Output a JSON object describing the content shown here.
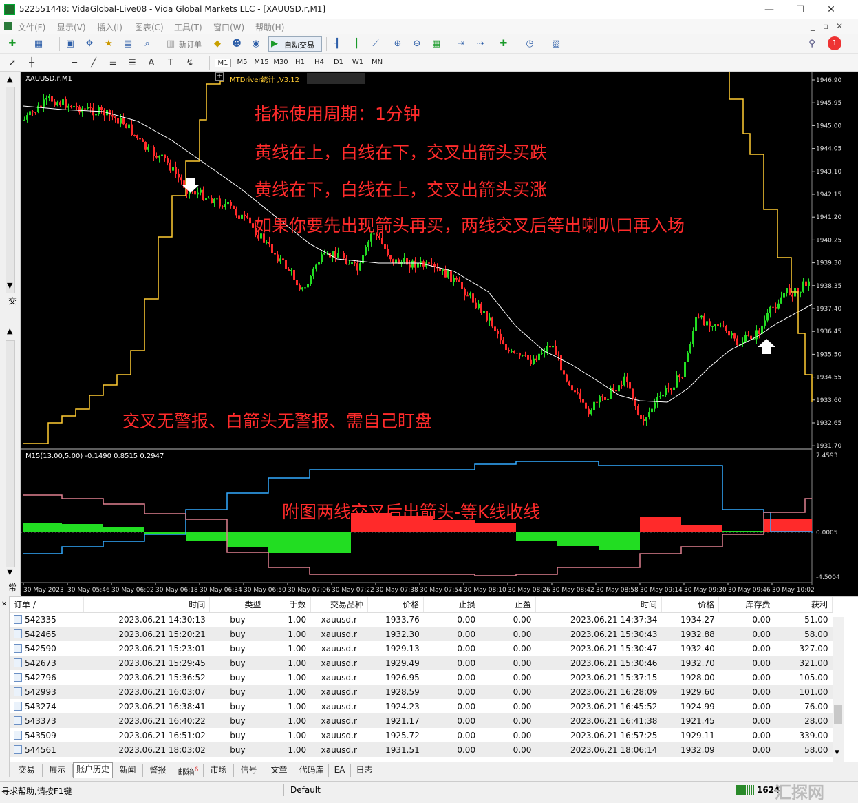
{
  "window": {
    "title": "522551448: VidaGlobal-Live08 - Vida Global Markets LLC - [XAUUSD.r,M1]"
  },
  "menu": [
    "文件(F)",
    "显示(V)",
    "插入(I)",
    "图表(C)",
    "工具(T)",
    "窗口(W)",
    "帮助(H)"
  ],
  "toolbar": {
    "new_order": "新订单",
    "auto_trade": "自动交易"
  },
  "timeframes": [
    "M1",
    "M5",
    "M15",
    "M30",
    "H1",
    "H4",
    "D1",
    "W1",
    "MN"
  ],
  "left_panel": {
    "tab1": "交",
    "tab2": "常"
  },
  "chart": {
    "symbol_label": "XAUUSD.r,M1",
    "indicator_label": "MTDriver统计 ,V3.12",
    "sub_label": "M15(13.00,5.00) -0.1490 0.8515 0.2947",
    "price_ticks": [
      "1946.90",
      "1945.95",
      "1945.00",
      "1944.05",
      "1943.10",
      "1942.15",
      "1941.20",
      "1940.25",
      "1939.30",
      "1938.35",
      "1937.40",
      "1936.45",
      "1935.50",
      "1934.55",
      "1933.60",
      "1932.65",
      "1931.70"
    ],
    "sub_ticks": [
      "7.4593",
      "0.0005",
      "-4.5004"
    ],
    "time_ticks": [
      "30 May 2023",
      "30 May 05:46",
      "30 May 06:02",
      "30 May 06:18",
      "30 May 06:34",
      "30 May 06:50",
      "30 May 07:06",
      "30 May 07:22",
      "30 May 07:38",
      "30 May 07:54",
      "30 May 08:10",
      "30 May 08:26",
      "30 May 08:42",
      "30 May 08:58",
      "30 May 09:14",
      "30 May 09:30",
      "30 May 09:46",
      "30 May 10:02"
    ],
    "annotations": {
      "a1": "指标使用周期：1分钟",
      "a2": "黄线在上，白线在下，交叉出箭头买跌",
      "a3": "黄线在下，白线在上，交叉出箭头买涨",
      "a4": "如果你要先出现箭头再买，两线交叉后等出喇叭口再入场",
      "a5": "交叉无警报、白箭头无警报、需自己盯盘",
      "a6": "附图两线交叉后出箭头-等K线收线"
    },
    "colors": {
      "bull": "#22dd22",
      "bear": "#ff2a2a",
      "yellow": "#ffcc33",
      "white": "#ffffff",
      "blue": "#33aaff",
      "pink": "#e08090"
    }
  },
  "orders": {
    "headers": [
      "订单 /",
      "时间",
      "类型",
      "手数",
      "交易品种",
      "价格",
      "止损",
      "止盈",
      "时间",
      "价格",
      "库存费",
      "获利"
    ],
    "rows": [
      [
        "542335",
        "2023.06.21 14:30:13",
        "buy",
        "1.00",
        "xauusd.r",
        "1933.76",
        "0.00",
        "0.00",
        "2023.06.21 14:37:34",
        "1934.27",
        "0.00",
        "51.00"
      ],
      [
        "542465",
        "2023.06.21 15:20:21",
        "buy",
        "1.00",
        "xauusd.r",
        "1932.30",
        "0.00",
        "0.00",
        "2023.06.21 15:30:43",
        "1932.88",
        "0.00",
        "58.00"
      ],
      [
        "542590",
        "2023.06.21 15:23:01",
        "buy",
        "1.00",
        "xauusd.r",
        "1929.13",
        "0.00",
        "0.00",
        "2023.06.21 15:30:47",
        "1932.40",
        "0.00",
        "327.00"
      ],
      [
        "542673",
        "2023.06.21 15:29:45",
        "buy",
        "1.00",
        "xauusd.r",
        "1929.49",
        "0.00",
        "0.00",
        "2023.06.21 15:30:46",
        "1932.70",
        "0.00",
        "321.00"
      ],
      [
        "542796",
        "2023.06.21 15:36:52",
        "buy",
        "1.00",
        "xauusd.r",
        "1926.95",
        "0.00",
        "0.00",
        "2023.06.21 15:37:15",
        "1928.00",
        "0.00",
        "105.00"
      ],
      [
        "542993",
        "2023.06.21 16:03:07",
        "buy",
        "1.00",
        "xauusd.r",
        "1928.59",
        "0.00",
        "0.00",
        "2023.06.21 16:28:09",
        "1929.60",
        "0.00",
        "101.00"
      ],
      [
        "543274",
        "2023.06.21 16:38:41",
        "buy",
        "1.00",
        "xauusd.r",
        "1924.23",
        "0.00",
        "0.00",
        "2023.06.21 16:45:52",
        "1924.99",
        "0.00",
        "76.00"
      ],
      [
        "543373",
        "2023.06.21 16:40:22",
        "buy",
        "1.00",
        "xauusd.r",
        "1921.17",
        "0.00",
        "0.00",
        "2023.06.21 16:41:38",
        "1921.45",
        "0.00",
        "28.00"
      ],
      [
        "543509",
        "2023.06.21 16:51:02",
        "buy",
        "1.00",
        "xauusd.r",
        "1925.72",
        "0.00",
        "0.00",
        "2023.06.21 16:57:25",
        "1929.11",
        "0.00",
        "339.00"
      ],
      [
        "544561",
        "2023.06.21 18:03:02",
        "buy",
        "1.00",
        "xauusd.r",
        "1931.51",
        "0.00",
        "0.00",
        "2023.06.21 18:06:14",
        "1932.09",
        "0.00",
        "58.00"
      ]
    ]
  },
  "tabs": [
    "交易",
    "展示",
    "账户历史",
    "新闻",
    "警报",
    "邮箱",
    "市场",
    "信号",
    "文章",
    "代码库",
    "EA",
    "日志"
  ],
  "mail_badge": "6",
  "status": {
    "help": "寻求帮助,请按F1键",
    "profile": "Default",
    "traffic": "1624",
    "watermark": "汇探网"
  }
}
